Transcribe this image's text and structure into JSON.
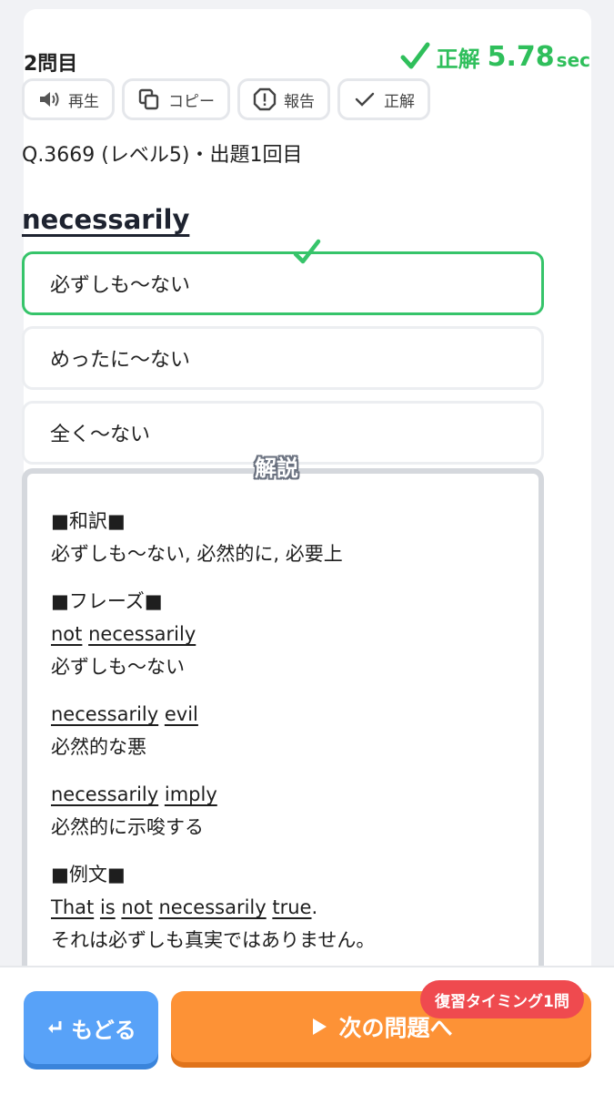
{
  "question": {
    "number_label": "2問目",
    "result_label": "正解",
    "time": "5.78",
    "time_unit": "sec",
    "meta": "Q.3669 (レベル5)・出題1回目",
    "word": "necessarily"
  },
  "actions": [
    {
      "label": "再生",
      "icon": "speaker-icon"
    },
    {
      "label": "コピー",
      "icon": "copy-icon"
    },
    {
      "label": "報告",
      "icon": "alert-icon"
    },
    {
      "label": "正解",
      "icon": "check-icon"
    }
  ],
  "choices": [
    {
      "label": "必ずしも〜ない",
      "state": "correct"
    },
    {
      "label": "めったに〜ない",
      "state": "normal"
    },
    {
      "label": "全く〜ない",
      "state": "normal"
    }
  ],
  "explanation": {
    "title": "解説",
    "translation_heading": "■和訳■",
    "translation": "必ずしも〜ない, 必然的に, 必要上",
    "phrases_heading": "■フレーズ■",
    "phrases": [
      {
        "words": [
          "not",
          "necessarily"
        ],
        "meaning": "必ずしも〜ない"
      },
      {
        "words": [
          "necessarily",
          "evil"
        ],
        "meaning": "必然的な悪"
      },
      {
        "words": [
          "necessarily",
          "imply"
        ],
        "meaning": "必然的に示唆する"
      }
    ],
    "example_heading": "■例文■",
    "example_words": [
      "That",
      "is",
      "not",
      "necessarily",
      "true"
    ],
    "example_end": ".",
    "example_translation": "それは必ずしも真実ではありません。"
  },
  "bottom": {
    "back_label": "もどる",
    "next_label": "次の問題へ",
    "review_badge": "復習タイミング1問"
  },
  "colors": {
    "correct_green": "#36c46a",
    "back_blue": "#58a2f8",
    "next_orange": "#fd9236",
    "badge_red": "#ef4a4f"
  }
}
